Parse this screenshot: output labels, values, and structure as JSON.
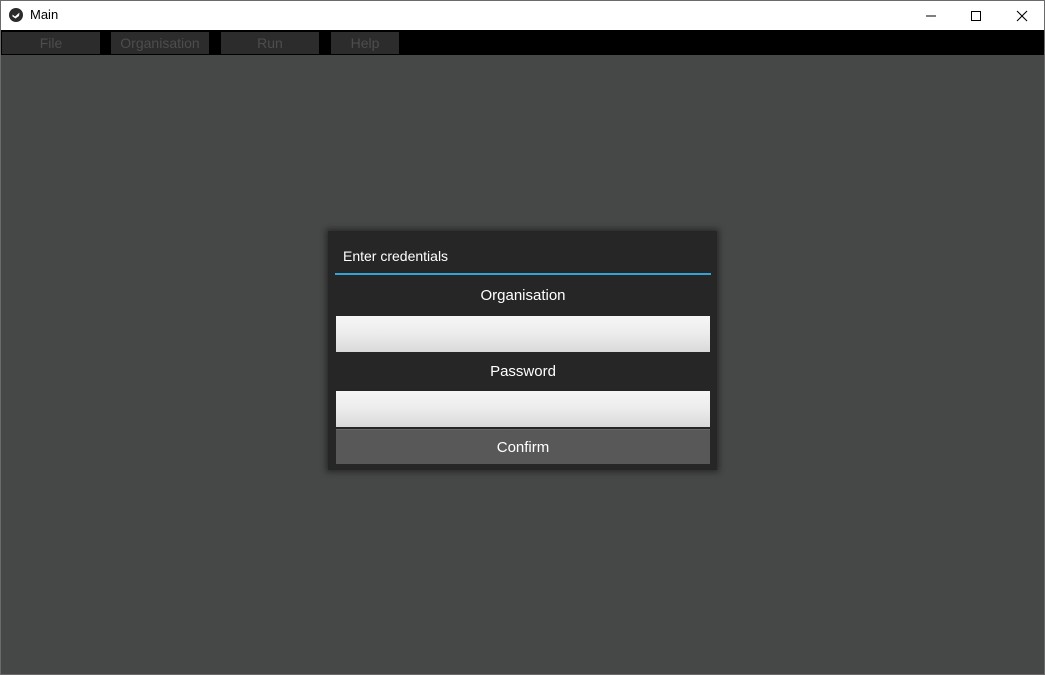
{
  "window": {
    "title": "Main",
    "app_icon": "kivy-logo-icon",
    "controls": {
      "minimize_icon": "minimize-icon",
      "maximize_icon": "maximize-icon",
      "close_icon": "close-icon"
    }
  },
  "menubar": {
    "items": [
      {
        "label": "File"
      },
      {
        "label": "Organisation"
      },
      {
        "label": "Run"
      },
      {
        "label": "Help"
      }
    ]
  },
  "dialog": {
    "title": "Enter credentials",
    "organisation_label": "Organisation",
    "organisation_value": "",
    "password_label": "Password",
    "password_value": "",
    "confirm_label": "Confirm"
  },
  "colors": {
    "background": "#464847",
    "menubar": "#000000",
    "menu_item_bg": "#2c2c2c",
    "menu_item_text": "#4d4d4d",
    "dialog_bg": "#262626",
    "dialog_separator": "#33a2d4",
    "confirm_button": "#585858"
  }
}
